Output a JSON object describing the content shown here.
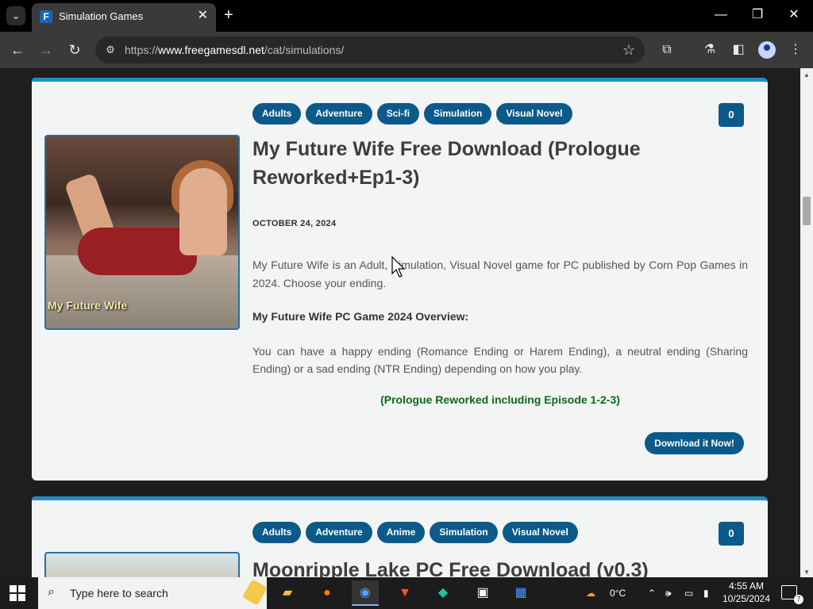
{
  "browser": {
    "tab_title": "Simulation Games",
    "tab_favicon": "F",
    "url_prefix": "https://",
    "url_domain": "www.freegamesdl.net",
    "url_path": "/cat/simulations/"
  },
  "posts": [
    {
      "tags": [
        "Adults",
        "Adventure",
        "Sci-fi",
        "Simulation",
        "Visual Novel"
      ],
      "comments": "0",
      "thumbnail_caption": "My Future Wife",
      "title": "My Future Wife Free Download (Prologue Reworked+Ep1-3)",
      "date": "OCTOBER 24, 2024",
      "description": "My Future Wife is an Adult, Simulation, Visual Novel game for PC published by Corn Pop Games in 2024. Choose your ending.",
      "overview_heading": "My Future Wife PC Game 2024 Overview:",
      "overview_text": "You can have a happy ending (Romance Ending or Harem Ending), a neutral ending (Sharing Ending) or a sad ending (NTR Ending) depending on how you play.",
      "highlight": "(Prologue Reworked including Episode 1-2-3)",
      "download_label": "Download it Now!"
    },
    {
      "tags": [
        "Adults",
        "Adventure",
        "Anime",
        "Simulation",
        "Visual Novel"
      ],
      "comments": "0",
      "title": "Moonripple Lake PC Free Download (v0.3)"
    }
  ],
  "taskbar": {
    "search_placeholder": "Type here to search",
    "weather": "0°C",
    "time": "4:55 AM",
    "date": "10/25/2024",
    "notification_count": "7"
  },
  "colors": {
    "accent": "#1c8fc7",
    "tag_bg": "#0b5a8a",
    "highlight_text": "#0a6a1a"
  }
}
